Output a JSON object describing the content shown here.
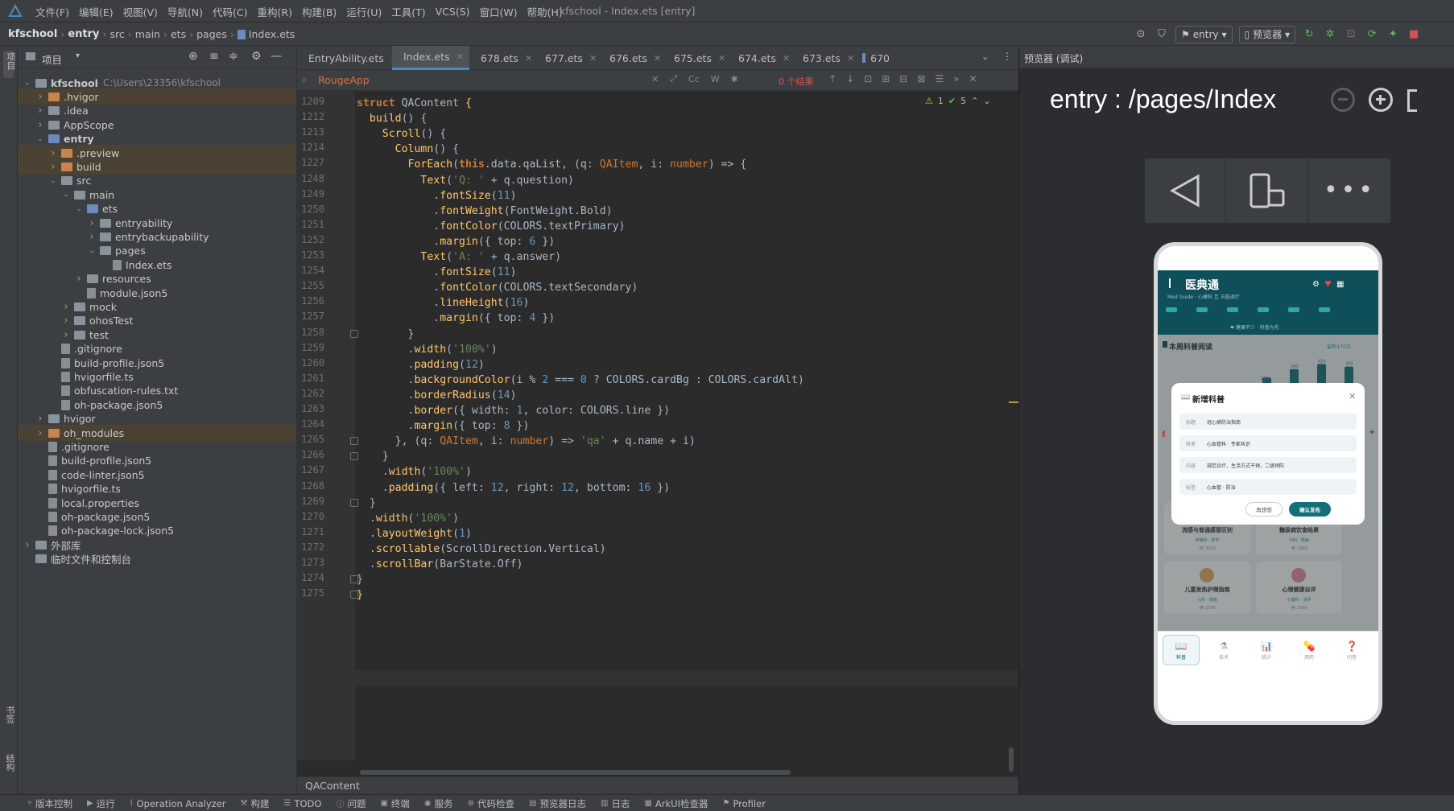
{
  "window": {
    "title": "kfschool - Index.ets [entry]"
  },
  "menu": [
    "文件(F)",
    "编辑(E)",
    "视图(V)",
    "导航(N)",
    "代码(C)",
    "重构(R)",
    "构建(B)",
    "运行(U)",
    "工具(T)",
    "VCS(S)",
    "窗口(W)",
    "帮助(H)"
  ],
  "breadcrumb": [
    "kfschool",
    "entry",
    "src",
    "main",
    "ets",
    "pages",
    "Index.ets"
  ],
  "toolbar": {
    "module": "entry",
    "previewer": "预览器"
  },
  "leftstrip": {
    "project": "项目",
    "bookmarks": "书签",
    "structure": "结构"
  },
  "project": {
    "header": "项目",
    "tree": [
      {
        "label": "kfschool",
        "path": "C:\\Users\\23356\\kfschool",
        "level": 0,
        "kind": "folder",
        "arrow": "open",
        "bold": true
      },
      {
        "label": ".hvigor",
        "level": 1,
        "kind": "folder-orange",
        "arrow": "closed",
        "hl": true
      },
      {
        "label": ".idea",
        "level": 1,
        "kind": "folder",
        "arrow": "closed"
      },
      {
        "label": "AppScope",
        "level": 1,
        "kind": "folder",
        "arrow": "closed"
      },
      {
        "label": "entry",
        "level": 1,
        "kind": "folder-blue",
        "arrow": "open",
        "bold": true
      },
      {
        "label": ".preview",
        "level": 2,
        "kind": "folder-orange",
        "arrow": "closed",
        "hl": true
      },
      {
        "label": "build",
        "level": 2,
        "kind": "folder-orange",
        "arrow": "closed",
        "hl": true
      },
      {
        "label": "src",
        "level": 2,
        "kind": "folder",
        "arrow": "open"
      },
      {
        "label": "main",
        "level": 3,
        "kind": "folder",
        "arrow": "open"
      },
      {
        "label": "ets",
        "level": 4,
        "kind": "folder-blue",
        "arrow": "open"
      },
      {
        "label": "entryability",
        "level": 5,
        "kind": "folder",
        "arrow": "closed"
      },
      {
        "label": "entrybackupability",
        "level": 5,
        "kind": "folder",
        "arrow": "closed"
      },
      {
        "label": "pages",
        "level": 5,
        "kind": "folder",
        "arrow": "open"
      },
      {
        "label": "Index.ets",
        "level": 6,
        "kind": "file",
        "arrow": "none"
      },
      {
        "label": "resources",
        "level": 4,
        "kind": "folder",
        "arrow": "closed"
      },
      {
        "label": "module.json5",
        "level": 4,
        "kind": "file",
        "arrow": "none"
      },
      {
        "label": "mock",
        "level": 3,
        "kind": "folder",
        "arrow": "closed"
      },
      {
        "label": "ohosTest",
        "level": 3,
        "kind": "folder",
        "arrow": "closed"
      },
      {
        "label": "test",
        "level": 3,
        "kind": "folder",
        "arrow": "closed"
      },
      {
        "label": ".gitignore",
        "level": 2,
        "kind": "file",
        "arrow": "none"
      },
      {
        "label": "build-profile.json5",
        "level": 2,
        "kind": "file",
        "arrow": "none"
      },
      {
        "label": "hvigorfile.ts",
        "level": 2,
        "kind": "file",
        "arrow": "none"
      },
      {
        "label": "obfuscation-rules.txt",
        "level": 2,
        "kind": "file",
        "arrow": "none"
      },
      {
        "label": "oh-package.json5",
        "level": 2,
        "kind": "file",
        "arrow": "none"
      },
      {
        "label": "hvigor",
        "level": 1,
        "kind": "folder",
        "arrow": "closed"
      },
      {
        "label": "oh_modules",
        "level": 1,
        "kind": "folder-orange",
        "arrow": "closed",
        "hl": true
      },
      {
        "label": ".gitignore",
        "level": 1,
        "kind": "file",
        "arrow": "none"
      },
      {
        "label": "build-profile.json5",
        "level": 1,
        "kind": "file",
        "arrow": "none"
      },
      {
        "label": "code-linter.json5",
        "level": 1,
        "kind": "file",
        "arrow": "none"
      },
      {
        "label": "hvigorfile.ts",
        "level": 1,
        "kind": "file",
        "arrow": "none"
      },
      {
        "label": "local.properties",
        "level": 1,
        "kind": "file",
        "arrow": "none"
      },
      {
        "label": "oh-package.json5",
        "level": 1,
        "kind": "file",
        "arrow": "none"
      },
      {
        "label": "oh-package-lock.json5",
        "level": 1,
        "kind": "file",
        "arrow": "none"
      },
      {
        "label": "外部库",
        "level": 0,
        "kind": "lib",
        "arrow": "closed"
      },
      {
        "label": "临时文件和控制台",
        "level": 0,
        "kind": "lib",
        "arrow": "none"
      }
    ]
  },
  "tabs": [
    {
      "label": "EntryAbility.ets",
      "active": false
    },
    {
      "label": "Index.ets",
      "active": true
    },
    {
      "label": "678.ets",
      "active": false
    },
    {
      "label": "677.ets",
      "active": false
    },
    {
      "label": "676.ets",
      "active": false
    },
    {
      "label": "675.ets",
      "active": false
    },
    {
      "label": "674.ets",
      "active": false
    },
    {
      "label": "673.ets",
      "active": false
    },
    {
      "label": "670",
      "active": false
    }
  ],
  "find": {
    "query": "RougeApp",
    "results": "0 个结果",
    "opt_case": "Cc",
    "opt_word": "W"
  },
  "inspection": {
    "warn": "1",
    "ok": "5"
  },
  "code": {
    "lines": [
      {
        "n": "1209",
        "fold": false,
        "t": [
          [
            "kw",
            "struct "
          ],
          [
            "pl",
            "QAContent "
          ],
          [
            "fn",
            "{"
          ]
        ]
      },
      {
        "n": "1212",
        "fold": false,
        "t": [
          [
            "pl",
            "  "
          ],
          [
            "me",
            "build"
          ],
          [
            "pl",
            "() {"
          ]
        ]
      },
      {
        "n": "1213",
        "fold": false,
        "t": [
          [
            "pl",
            "    "
          ],
          [
            "me",
            "Scroll"
          ],
          [
            "pl",
            "() {"
          ]
        ]
      },
      {
        "n": "1214",
        "fold": false,
        "t": [
          [
            "pl",
            "      "
          ],
          [
            "me",
            "Column"
          ],
          [
            "pl",
            "() {"
          ]
        ]
      },
      {
        "n": "1227",
        "fold": false,
        "t": [
          [
            "pl",
            "        "
          ],
          [
            "me",
            "ForEach"
          ],
          [
            "pl",
            "("
          ],
          [
            "kw",
            "this"
          ],
          [
            "pl",
            ".data.qaList, (q: "
          ],
          [
            "ty",
            "QAItem"
          ],
          [
            "pl",
            ", i: "
          ],
          [
            "ty",
            "number"
          ],
          [
            "pl",
            ") => {"
          ]
        ]
      },
      {
        "n": "1248",
        "fold": false,
        "t": [
          [
            "pl",
            "          "
          ],
          [
            "me",
            "Text"
          ],
          [
            "pl",
            "("
          ],
          [
            "st",
            "'Q: '"
          ],
          [
            "pl",
            " + q.question)"
          ]
        ]
      },
      {
        "n": "1249",
        "fold": false,
        "t": [
          [
            "pl",
            "            ."
          ],
          [
            "me",
            "fontSize"
          ],
          [
            "pl",
            "("
          ],
          [
            "nm",
            "11"
          ],
          [
            "pl",
            ")"
          ]
        ]
      },
      {
        "n": "1250",
        "fold": false,
        "t": [
          [
            "pl",
            "            ."
          ],
          [
            "me",
            "fontWeight"
          ],
          [
            "pl",
            "(FontWeight.Bold)"
          ]
        ]
      },
      {
        "n": "1251",
        "fold": false,
        "t": [
          [
            "pl",
            "            ."
          ],
          [
            "me",
            "fontColor"
          ],
          [
            "pl",
            "(COLORS.textPrimary)"
          ]
        ]
      },
      {
        "n": "1252",
        "fold": false,
        "t": [
          [
            "pl",
            "            ."
          ],
          [
            "me",
            "margin"
          ],
          [
            "pl",
            "({ top: "
          ],
          [
            "nm",
            "6"
          ],
          [
            "pl",
            " })"
          ]
        ]
      },
      {
        "n": "1253",
        "fold": false,
        "t": [
          [
            "pl",
            "          "
          ],
          [
            "me",
            "Text"
          ],
          [
            "pl",
            "("
          ],
          [
            "st",
            "'A: '"
          ],
          [
            "pl",
            " + q.answer)"
          ]
        ]
      },
      {
        "n": "1254",
        "fold": false,
        "t": [
          [
            "pl",
            "            ."
          ],
          [
            "me",
            "fontSize"
          ],
          [
            "pl",
            "("
          ],
          [
            "nm",
            "11"
          ],
          [
            "pl",
            ")"
          ]
        ]
      },
      {
        "n": "1255",
        "fold": false,
        "t": [
          [
            "pl",
            "            ."
          ],
          [
            "me",
            "fontColor"
          ],
          [
            "pl",
            "(COLORS.textSecondary)"
          ]
        ]
      },
      {
        "n": "1256",
        "fold": false,
        "t": [
          [
            "pl",
            "            ."
          ],
          [
            "me",
            "lineHeight"
          ],
          [
            "pl",
            "("
          ],
          [
            "nm",
            "16"
          ],
          [
            "pl",
            ")"
          ]
        ]
      },
      {
        "n": "1257",
        "fold": false,
        "t": [
          [
            "pl",
            "            ."
          ],
          [
            "me",
            "margin"
          ],
          [
            "pl",
            "({ top: "
          ],
          [
            "nm",
            "4"
          ],
          [
            "pl",
            " })"
          ]
        ]
      },
      {
        "n": "1258",
        "fold": true,
        "t": [
          [
            "pl",
            "        }"
          ]
        ]
      },
      {
        "n": "1259",
        "fold": false,
        "t": [
          [
            "pl",
            "        ."
          ],
          [
            "me",
            "width"
          ],
          [
            "pl",
            "("
          ],
          [
            "st",
            "'100%'"
          ],
          [
            "pl",
            ")"
          ]
        ]
      },
      {
        "n": "1260",
        "fold": false,
        "t": [
          [
            "pl",
            "        ."
          ],
          [
            "me",
            "padding"
          ],
          [
            "pl",
            "("
          ],
          [
            "nm",
            "12"
          ],
          [
            "pl",
            ")"
          ]
        ]
      },
      {
        "n": "1261",
        "fold": false,
        "t": [
          [
            "pl",
            "        ."
          ],
          [
            "me",
            "backgroundColor"
          ],
          [
            "pl",
            "(i % "
          ],
          [
            "nm",
            "2"
          ],
          [
            "pl",
            " === "
          ],
          [
            "nm",
            "0"
          ],
          [
            "pl",
            " ? COLORS.cardBg : COLORS.cardAlt)"
          ]
        ]
      },
      {
        "n": "1262",
        "fold": false,
        "t": [
          [
            "pl",
            "        ."
          ],
          [
            "me",
            "borderRadius"
          ],
          [
            "pl",
            "("
          ],
          [
            "nm",
            "14"
          ],
          [
            "pl",
            ")"
          ]
        ]
      },
      {
        "n": "1263",
        "fold": false,
        "t": [
          [
            "pl",
            "        ."
          ],
          [
            "me",
            "border"
          ],
          [
            "pl",
            "({ width: "
          ],
          [
            "nm",
            "1"
          ],
          [
            "pl",
            ", color: COLORS.line })"
          ]
        ]
      },
      {
        "n": "1264",
        "fold": false,
        "t": [
          [
            "pl",
            "        ."
          ],
          [
            "me",
            "margin"
          ],
          [
            "pl",
            "({ top: "
          ],
          [
            "nm",
            "8"
          ],
          [
            "pl",
            " })"
          ]
        ]
      },
      {
        "n": "1265",
        "fold": true,
        "t": [
          [
            "pl",
            "      }, (q: "
          ],
          [
            "ty",
            "QAItem"
          ],
          [
            "pl",
            ", i: "
          ],
          [
            "ty",
            "number"
          ],
          [
            "pl",
            ") => "
          ],
          [
            "st",
            "'qa'"
          ],
          [
            "pl",
            " + q.name + i)"
          ]
        ]
      },
      {
        "n": "1266",
        "fold": true,
        "t": [
          [
            "pl",
            "    }"
          ]
        ]
      },
      {
        "n": "1267",
        "fold": false,
        "t": [
          [
            "pl",
            "    ."
          ],
          [
            "me",
            "width"
          ],
          [
            "pl",
            "("
          ],
          [
            "st",
            "'100%'"
          ],
          [
            "pl",
            ")"
          ]
        ]
      },
      {
        "n": "1268",
        "fold": false,
        "t": [
          [
            "pl",
            "    ."
          ],
          [
            "me",
            "padding"
          ],
          [
            "pl",
            "({ left: "
          ],
          [
            "nm",
            "12"
          ],
          [
            "pl",
            ", right: "
          ],
          [
            "nm",
            "12"
          ],
          [
            "pl",
            ", bottom: "
          ],
          [
            "nm",
            "16"
          ],
          [
            "pl",
            " })"
          ]
        ]
      },
      {
        "n": "1269",
        "fold": true,
        "t": [
          [
            "pl",
            "  }"
          ]
        ]
      },
      {
        "n": "1270",
        "fold": false,
        "t": [
          [
            "pl",
            "  ."
          ],
          [
            "me",
            "width"
          ],
          [
            "pl",
            "("
          ],
          [
            "st",
            "'100%'"
          ],
          [
            "pl",
            ")"
          ]
        ]
      },
      {
        "n": "1271",
        "fold": false,
        "t": [
          [
            "pl",
            "  ."
          ],
          [
            "me",
            "layoutWeight"
          ],
          [
            "pl",
            "("
          ],
          [
            "nm",
            "1"
          ],
          [
            "pl",
            ")"
          ]
        ]
      },
      {
        "n": "1272",
        "fold": false,
        "t": [
          [
            "pl",
            "  ."
          ],
          [
            "me",
            "scrollable"
          ],
          [
            "pl",
            "(ScrollDirection.Vertical)"
          ]
        ]
      },
      {
        "n": "1273",
        "fold": false,
        "t": [
          [
            "pl",
            "  ."
          ],
          [
            "me",
            "scrollBar"
          ],
          [
            "pl",
            "(BarState.Off)"
          ]
        ]
      },
      {
        "n": "1274",
        "fold": true,
        "t": [
          [
            "pl",
            "}"
          ]
        ]
      },
      {
        "n": "1275",
        "fold": true,
        "t": [
          [
            "fn",
            "}"
          ]
        ]
      }
    ]
  },
  "editor_status": "QAContent",
  "preview": {
    "header": "预览器 (调试)",
    "route": "entry : /pages/Index",
    "app": {
      "title": "医典通",
      "subtitle": "Med Guide · 心健科 互 五脏调疗",
      "hint": "❤ 健康不少 · 科普为先",
      "section": "本周科普阅读",
      "section_right": "最新470次",
      "bars": [
        {
          "label": "",
          "value": 210
        },
        {
          "label": "340",
          "value": 340
        },
        {
          "label": "420",
          "value": 420
        },
        {
          "label": "380",
          "value": 380
        }
      ],
      "bars_extra_label": "260",
      "dialog": {
        "title": "新增科普",
        "fields": [
          {
            "label": "标题",
            "value": "冠心病防治指南"
          },
          {
            "label": "科室",
            "value": "心血管科 · 专家共识"
          },
          {
            "label": "内容",
            "value": "规范诊疗，生活方式干预，二级预防"
          },
          {
            "label": "标签",
            "value": "心血管 · 防治"
          }
        ],
        "cancel": "再想想",
        "confirm": "确认发布"
      },
      "cards": [
        {
          "title": "流感与普通感冒区别",
          "meta": "呼吸科 · 季节",
          "views": "👁 3420"
        },
        {
          "title": "糖尿病饮食结果",
          "meta": "内科 · 慢病",
          "views": "👁 1980"
        },
        {
          "title": "儿童发热护理指南",
          "meta": "儿科 · 家庭",
          "views": "👁 2760"
        },
        {
          "title": "心理健康自评",
          "meta": "心理科 · 测评",
          "views": "👁 1560"
        }
      ],
      "nav": [
        {
          "label": "科普",
          "glyph": "📖"
        },
        {
          "label": "技术",
          "glyph": "⚗"
        },
        {
          "label": "统计",
          "glyph": "📊"
        },
        {
          "label": "用药",
          "glyph": "💊"
        },
        {
          "label": "问答",
          "glyph": "❓"
        }
      ]
    }
  },
  "bottom": [
    "版本控制",
    "运行",
    "Operation Analyzer",
    "构建",
    "TODO",
    "问题",
    "终端",
    "服务",
    "代码检查",
    "预览器日志",
    "日志",
    "ArkUI检查器",
    "Profiler"
  ],
  "colors": {
    "accent": "#4a88c7",
    "app_primary": "#0f4f5a",
    "app_button": "#13707a"
  }
}
